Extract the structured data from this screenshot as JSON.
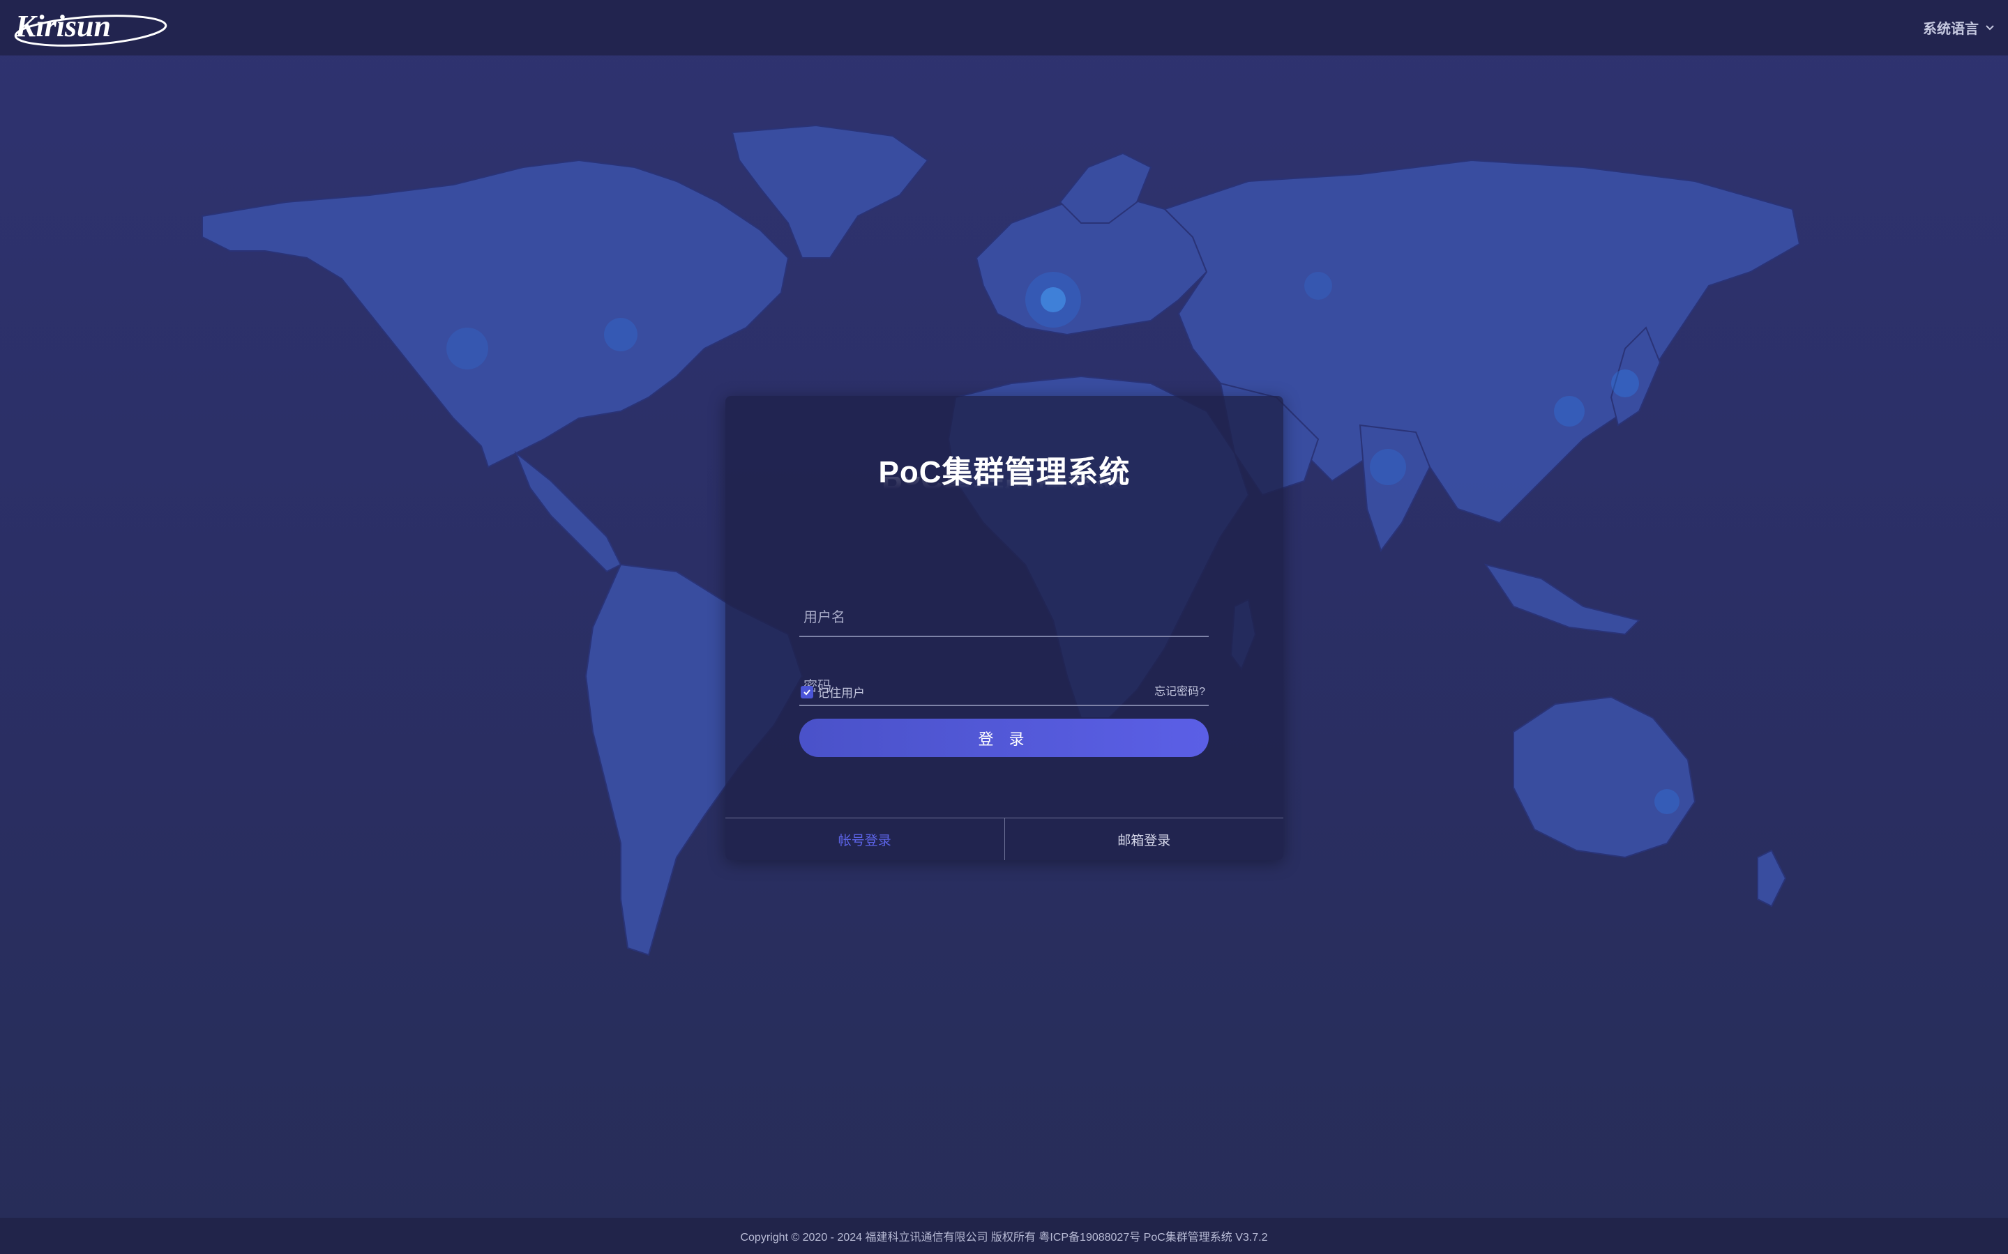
{
  "header": {
    "logo_text": "Kirisun",
    "language_label": "系统语言"
  },
  "login": {
    "title": "PoC集群管理系统",
    "username_placeholder": "用户名",
    "password_placeholder": "密码",
    "remember_label": "记住用户",
    "remember_checked": true,
    "forgot_label": "忘记密码?",
    "login_button": "登 录",
    "tabs": [
      {
        "label": "帐号登录",
        "active": true
      },
      {
        "label": "邮箱登录",
        "active": false
      }
    ]
  },
  "footer": {
    "copyright": "Copyright © 2020 - 2024 福建科立讯通信有限公司 版权所有 粤ICP备19088027号 PoC集群管理系统 V3.7.2"
  },
  "colors": {
    "background": "#2b2f66",
    "header": "#22244f",
    "accent": "#5b5fe6",
    "map_land": "#3a4fa3",
    "city_lights": "#2d8cff"
  }
}
